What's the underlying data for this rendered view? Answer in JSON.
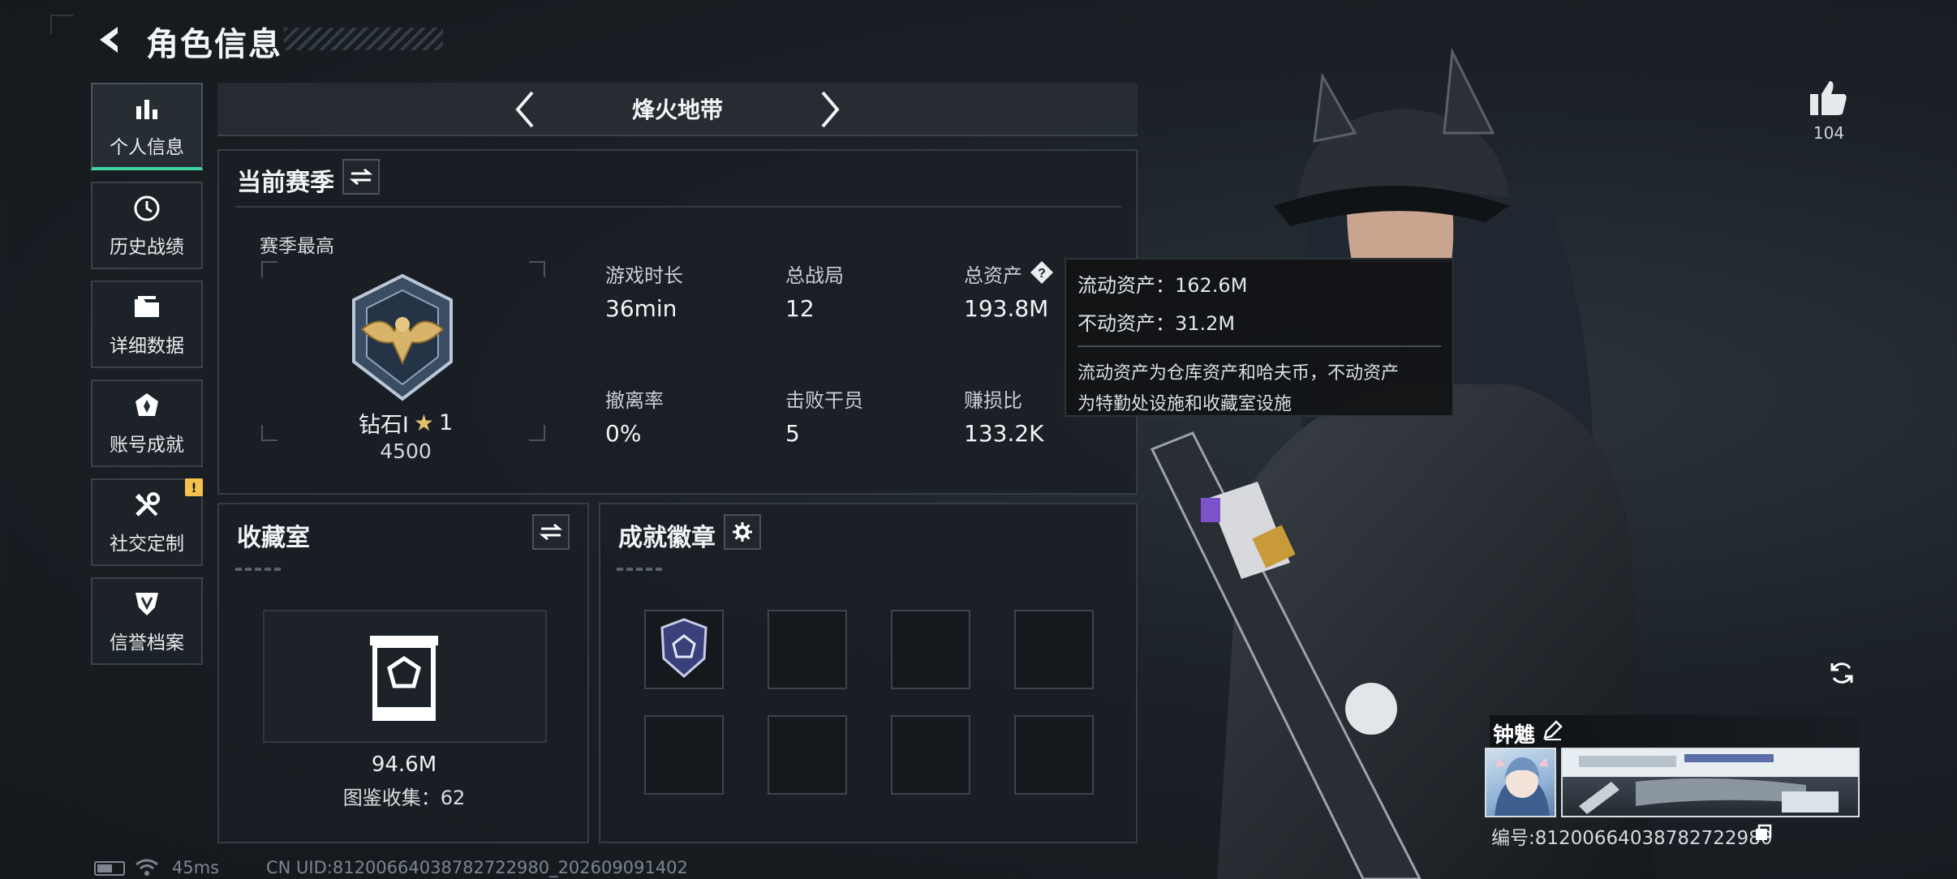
{
  "header": {
    "title": "角色信息",
    "back_icon": "back-arrow-icon"
  },
  "sidebar": {
    "items": [
      {
        "label": "个人信息",
        "icon": "bar-chart-icon",
        "active": true
      },
      {
        "label": "历史战绩",
        "icon": "history-clock-icon",
        "active": false
      },
      {
        "label": "详细数据",
        "icon": "folder-icon",
        "active": false
      },
      {
        "label": "账号成就",
        "icon": "achievement-icon",
        "active": false
      },
      {
        "label": "社交定制",
        "icon": "tools-icon",
        "active": false,
        "badge": "!"
      },
      {
        "label": "信誉档案",
        "icon": "credit-shield-icon",
        "active": false
      }
    ]
  },
  "mode": {
    "label": "烽火地带"
  },
  "season": {
    "title": "当前赛季",
    "best_label": "赛季最高",
    "rank_name": "钻石Ⅰ",
    "rank_stars": "1",
    "rank_score": "4500",
    "stats": [
      {
        "label": "游戏时长",
        "value": "36min"
      },
      {
        "label": "总战局",
        "value": "12"
      },
      {
        "label": "总资产",
        "value": "193.8M"
      },
      {
        "label": "撤离率",
        "value": "0%"
      },
      {
        "label": "击败干员",
        "value": "5"
      },
      {
        "label": "赚损比",
        "value": "133.2K"
      }
    ]
  },
  "tooltip": {
    "liquid": "流动资产：162.6M",
    "fixed": "不动资产：31.2M",
    "desc_line1": "流动资产为仓库资产和哈夫币，不动资产",
    "desc_line2": "为特勤处设施和收藏室设施"
  },
  "collection": {
    "title": "收藏室",
    "value": "94.6M",
    "catalog": "图鉴收集：62"
  },
  "badges": {
    "title": "成就徽章"
  },
  "profile": {
    "likes": "104",
    "name": "钟魋",
    "id_text": "编号:81200664038782722980"
  },
  "status": {
    "ping": "45ms",
    "uid": "CN UID:81200664038782722980_202609091402"
  },
  "colors": {
    "accent": "#3fd6a0",
    "warning": "#f2c14e",
    "panel": "#1a1f25"
  }
}
